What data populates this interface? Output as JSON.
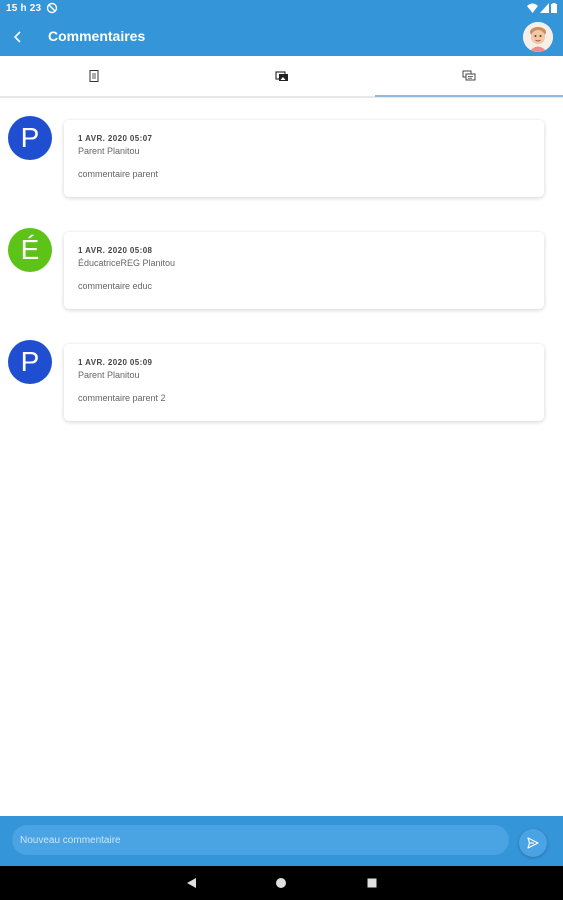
{
  "status_bar": {
    "time": "15 h 23"
  },
  "header": {
    "title": "Commentaires",
    "back_icon": "chevron-left-icon",
    "avatar_icon": "child-avatar"
  },
  "tabs": [
    {
      "icon": "notebook-icon"
    },
    {
      "icon": "photos-icon"
    },
    {
      "icon": "comments-icon",
      "selected": true
    }
  ],
  "comments": [
    {
      "initial": "P",
      "avatar_color": "#1f4fd0",
      "date": "1 AVR. 2020 05:07",
      "author": "Parent Planitou",
      "text": "commentaire parent"
    },
    {
      "initial": "É",
      "avatar_color": "#5ec317",
      "date": "1 AVR. 2020 05:08",
      "author": "ÉducatriceREG Planitou",
      "text": "commentaire educ"
    },
    {
      "initial": "P",
      "avatar_color": "#1f4fd0",
      "date": "1 AVR. 2020 05:09",
      "author": "Parent Planitou",
      "text": "commentaire parent 2"
    }
  ],
  "input": {
    "placeholder": "Nouveau commentaire",
    "value": ""
  },
  "colors": {
    "primary": "#3595d9",
    "tab_indicator": "#93b9e3"
  }
}
